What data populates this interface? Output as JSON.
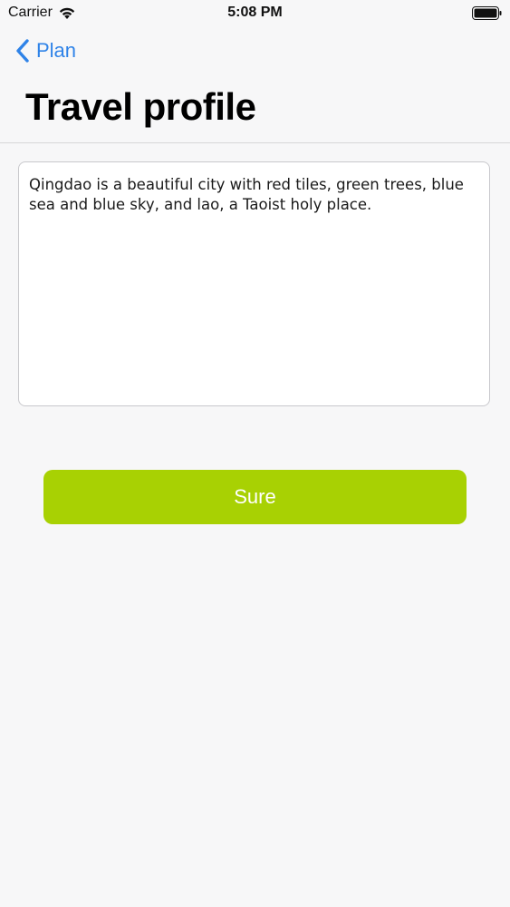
{
  "status_bar": {
    "carrier": "Carrier",
    "time": "5:08 PM",
    "icons": [
      "wifi-icon",
      "battery-icon"
    ]
  },
  "nav": {
    "back_label": "Plan",
    "back_icon": "chevron-left-icon",
    "title": "Travel profile"
  },
  "profile": {
    "text": "Qingdao is a beautiful city with red tiles, green trees, blue sea and blue sky, and lao, a Taoist holy place."
  },
  "actions": {
    "sure_label": "Sure"
  },
  "colors": {
    "accent": "#2f83e8",
    "button": "#a8d103",
    "background": "#f7f7f8"
  }
}
